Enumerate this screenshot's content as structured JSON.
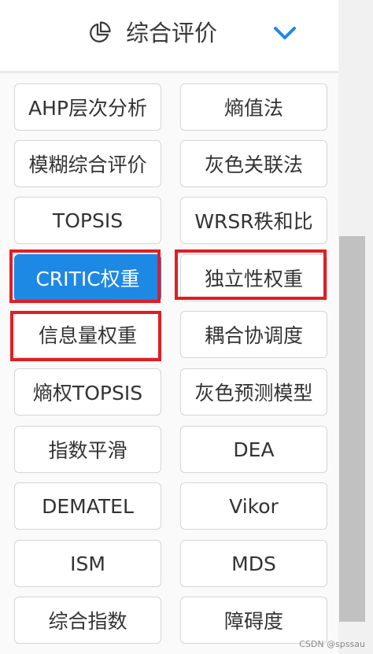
{
  "header": {
    "title": "综合评价",
    "icon": "pie-chart-icon",
    "expand_icon": "chevron-down-icon",
    "accent": "#1e88e5"
  },
  "buttons": [
    {
      "label": "AHP层次分析"
    },
    {
      "label": "熵值法"
    },
    {
      "label": "模糊综合评价"
    },
    {
      "label": "灰色关联法"
    },
    {
      "label": "TOPSIS"
    },
    {
      "label": "WRSR秩和比"
    },
    {
      "label": "CRITIC权重",
      "active": true,
      "highlighted": true
    },
    {
      "label": "独立性权重",
      "highlighted": true
    },
    {
      "label": "信息量权重",
      "highlighted": true
    },
    {
      "label": "耦合协调度"
    },
    {
      "label": "熵权TOPSIS"
    },
    {
      "label": "灰色预测模型"
    },
    {
      "label": "指数平滑"
    },
    {
      "label": "DEA"
    },
    {
      "label": "DEMATEL"
    },
    {
      "label": "Vikor"
    },
    {
      "label": "ISM"
    },
    {
      "label": "MDS"
    },
    {
      "label": "综合指数"
    },
    {
      "label": "障碍度"
    }
  ],
  "colors": {
    "highlight": "#e11d23",
    "active_button": "#1e88e5"
  },
  "watermark": "CSDN @spssau"
}
